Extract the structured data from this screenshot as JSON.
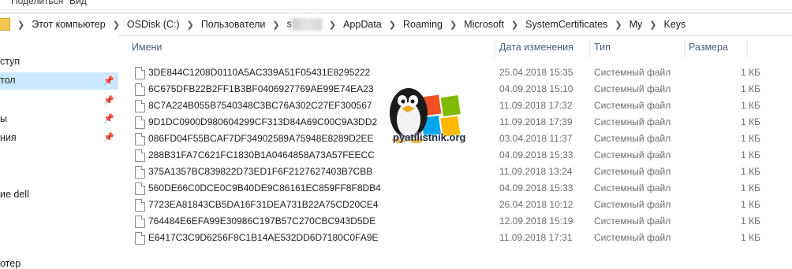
{
  "ribbon": {
    "share_label": "Поделиться",
    "view_label": "Вид"
  },
  "address": {
    "crumbs": [
      "Этот компьютер",
      "OSDisk (C:)",
      "Пользователи",
      "s",
      "AppData",
      "Roaming",
      "Microsoft",
      "SystemCertificates",
      "My",
      "Keys"
    ]
  },
  "sidebar": {
    "items": [
      "ступ",
      "тол",
      "",
      "ы",
      "ния",
      "ие dell",
      "отер"
    ]
  },
  "columns": {
    "name": "Имени",
    "date": "Дата изменения",
    "type": "Тип",
    "size": "Размера"
  },
  "files": [
    {
      "name": "3DE844C1208D0110A5AC339A51F05431E8295222",
      "date": "25.04.2018 15:35",
      "type": "Системный файл",
      "size": "1 КБ"
    },
    {
      "name": "6C675DFB22B2FF1B3BF0406927769AE99E74EA23",
      "date": "04.09.2018 15:10",
      "type": "Системный файл",
      "size": "1 КБ"
    },
    {
      "name": "8C7A224B055B7540348C3BC76A302C27EF300567",
      "date": "11.09.2018 17:32",
      "type": "Системный файл",
      "size": "1 КБ"
    },
    {
      "name": "9D1DC0900D980604299CF313D84A69C00C9A3DD2",
      "date": "11.09.2018 17:39",
      "type": "Системный файл",
      "size": "1 КБ"
    },
    {
      "name": "086FD04F55BCAF7DF34902589A75948E8289D2EE",
      "date": "03.04.2018 11:37",
      "type": "Системный файл",
      "size": "1 КБ"
    },
    {
      "name": "288B31FA7C621FC1830B1A0464858A73A57FEECC",
      "date": "04.09.2018 15:33",
      "type": "Системный файл",
      "size": "1 КБ"
    },
    {
      "name": "375A1357BC839822D73ED1F6F2127627403B7CBB",
      "date": "11.09.2018 13:24",
      "type": "Системный файл",
      "size": "1 КБ"
    },
    {
      "name": "560DE66C0DCE0C9B40DE9C86161EC859FF8F8DB4",
      "date": "04.09.2018 15:33",
      "type": "Системный файл",
      "size": "1 КБ"
    },
    {
      "name": "7723EA81843CB5DA16F31DEA731B22A75CD20CE4",
      "date": "26.04.2018 10:12",
      "type": "Системный файл",
      "size": "1 КБ"
    },
    {
      "name": "764484E6EFA99E30986C197B57C270CBC943D5DE",
      "date": "12.09.2018 15:19",
      "type": "Системный файл",
      "size": "1 КБ"
    },
    {
      "name": "E6417C3C9D6256F8C1B14AE532DD6D7180C0FA9E",
      "date": "11.09.2018 17:31",
      "type": "Системный файл",
      "size": "1 КБ"
    }
  ],
  "watermark": {
    "text": "pyatilistnik.org"
  }
}
